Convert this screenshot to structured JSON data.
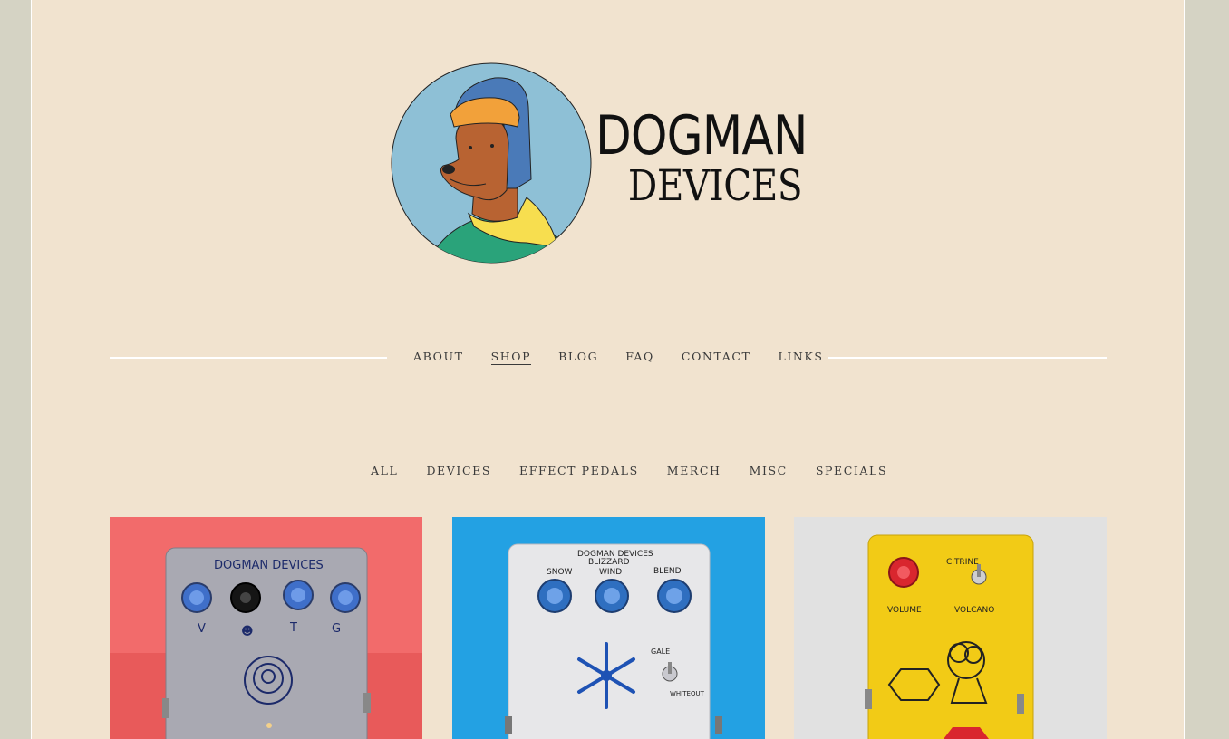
{
  "brand": {
    "name_line1": "DOGMAN",
    "name_line2": "DEVICES"
  },
  "nav": {
    "items": [
      {
        "label": "ABOUT",
        "active": false
      },
      {
        "label": "SHOP",
        "active": true
      },
      {
        "label": "BLOG",
        "active": false
      },
      {
        "label": "FAQ",
        "active": false
      },
      {
        "label": "CONTACT",
        "active": false
      },
      {
        "label": "LINKS",
        "active": false
      }
    ]
  },
  "categories": {
    "items": [
      {
        "label": "ALL"
      },
      {
        "label": "DEVICES"
      },
      {
        "label": "EFFECT PEDALS"
      },
      {
        "label": "MERCH"
      },
      {
        "label": "MISC"
      },
      {
        "label": "SPECIALS"
      }
    ]
  },
  "products": [
    {
      "brand_text": "DOGMAN DEVICES",
      "knob_labels": [
        "V",
        "T",
        "G"
      ],
      "bg_color": "#f26b6b"
    },
    {
      "brand_text": "DOGMAN DEVICES",
      "model_text": "BLIZZARD",
      "knob_labels": [
        "SNOW",
        "WIND",
        "BLEND"
      ],
      "switch_labels": [
        "GALE",
        "WHITEOUT"
      ],
      "bg_color": "#23a1e3"
    },
    {
      "knob_labels": [
        "VOLUME"
      ],
      "switch_labels": [
        "CITRINE",
        "VOLCANO"
      ],
      "bg_color": "#e1e1e1"
    }
  ],
  "colors": {
    "page_bg": "#f1e3cf",
    "outer_bg": "#d5d3c4",
    "text": "#3a3a3a"
  }
}
